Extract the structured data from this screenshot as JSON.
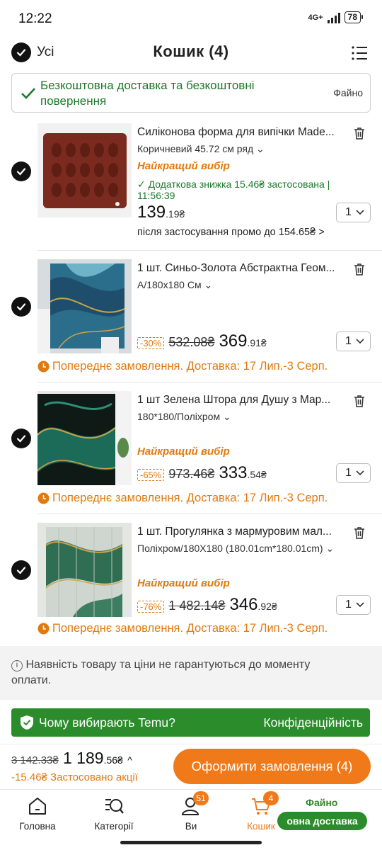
{
  "status": {
    "time": "12:22",
    "network": "4G+",
    "battery": "78"
  },
  "header": {
    "select_all": "Усі",
    "title": "Кошик (4)"
  },
  "banner": {
    "text": "Безкоштовна доставка та безкоштовні повернення",
    "tag": "Файно"
  },
  "items": [
    {
      "title": "Силіконова форма для випічки Made...",
      "variant": "Коричневий 45.72 см ряд",
      "badge": "Найкращий вибір",
      "extra": "Додаткова знижка 15.46₴ застосована | 11:56:39",
      "price_main": "139",
      "price_dec": ".19₴",
      "qty": "1",
      "promo": "після застосування промо до 154.65₴ >"
    },
    {
      "title": "1 шт. Синьо-Золота Абстрактна Геом...",
      "variant": "A/180x180 См",
      "discount": "-30%",
      "old_price": "532.08₴",
      "price_main": "369",
      "price_dec": ".91₴",
      "qty": "1",
      "preorder": "Попереднє замовлення. Доставка: 17 Лип.-3 Серп."
    },
    {
      "title": "1 шт Зелена Штора для Душу з Мар...",
      "variant": "180*180/Поліхром",
      "badge": "Найкращий вибір",
      "discount": "-65%",
      "old_price": "973.46₴",
      "price_main": "333",
      "price_dec": ".54₴",
      "qty": "1",
      "preorder": "Попереднє замовлення. Доставка: 17 Лип.-3 Серп."
    },
    {
      "title": "1 шт. Прогулянка з мармуровим мал...",
      "variant": "Поліхром/180X180 (180.01cm*180.01cm)",
      "badge": "Найкращий вибір",
      "discount": "-76%",
      "old_price": "1 482.14₴",
      "price_main": "346",
      "price_dec": ".92₴",
      "qty": "1",
      "preorder": "Попереднє замовлення. Доставка: 17 Лип.-3 Серп."
    }
  ],
  "notice": "Наявність товару та ціни не гарантуються до моменту оплати.",
  "why_bar": {
    "left": "Чому вибирають Temu?",
    "right": "Конфіденційність"
  },
  "checkout": {
    "old_total": "3 142.33₴",
    "total_main": "1 189",
    "total_dec": ".56₴",
    "applied": "-15.46₴ Застосовано акції",
    "button": "Оформити замовлення (4)"
  },
  "nav": {
    "home": "Головна",
    "categories": "Категорії",
    "you": "Ви",
    "you_badge": "51",
    "cart": "Кошик",
    "cart_badge": "4",
    "free_label": "Файно",
    "free_pill": "овна доставка"
  },
  "colors": {
    "accent": "#f07a1a",
    "green": "#2b8c2b",
    "best_orange": "#e07a10"
  }
}
